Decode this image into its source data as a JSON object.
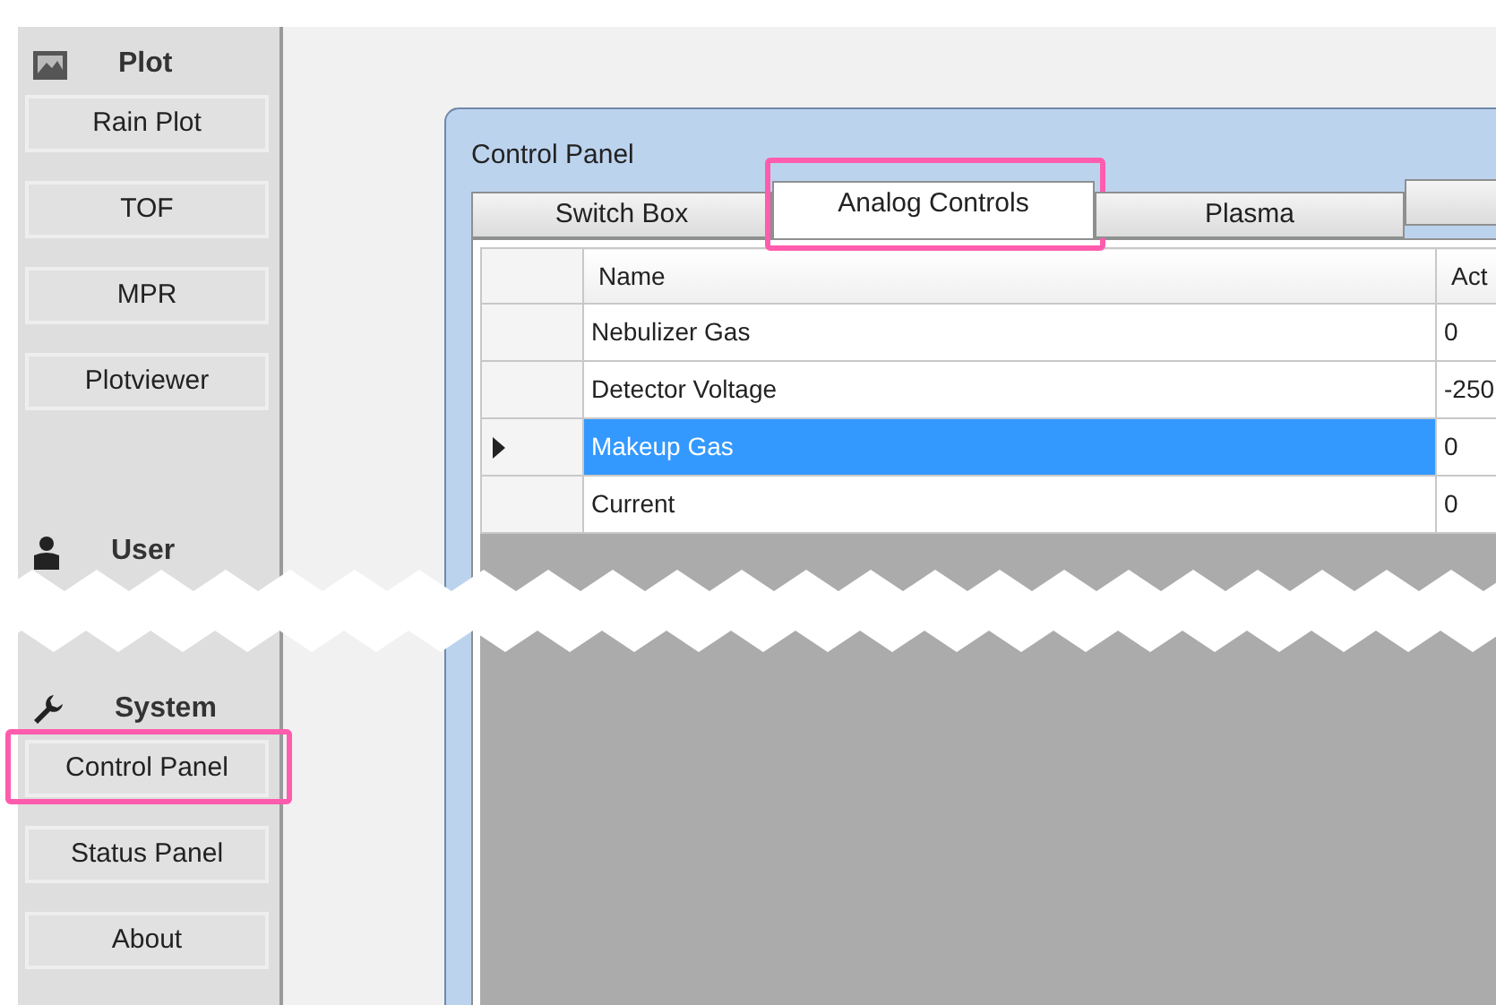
{
  "sidebar": {
    "sections": [
      {
        "title": "Plot",
        "buttons": [
          {
            "label": "Rain Plot",
            "highlighted": false
          },
          {
            "label": "TOF",
            "highlighted": false
          },
          {
            "label": "MPR",
            "highlighted": false
          },
          {
            "label": "Plotviewer",
            "highlighted": false
          }
        ]
      },
      {
        "title": "User"
      },
      {
        "title": "System",
        "buttons": [
          {
            "label": "Control Panel",
            "highlighted": true
          },
          {
            "label": "Status Panel",
            "highlighted": false
          },
          {
            "label": "About",
            "highlighted": false
          }
        ]
      }
    ]
  },
  "window": {
    "title": "Control Panel",
    "tabs": [
      {
        "label": "Switch Box",
        "selected": false,
        "highlighted": false
      },
      {
        "label": "Analog Controls",
        "selected": true,
        "highlighted": true
      },
      {
        "label": "Plasma",
        "selected": false,
        "highlighted": false
      },
      {
        "selected": false,
        "highlighted": false
      }
    ],
    "table": {
      "columns": [
        "Name",
        "Act"
      ],
      "rows": [
        {
          "cells": [
            "Nebulizer Gas",
            "0"
          ],
          "selected": false
        },
        {
          "cells": [
            "Detector Voltage",
            "-250"
          ],
          "selected": false
        },
        {
          "cells": [
            "Makeup Gas",
            "0"
          ],
          "selected": true
        },
        {
          "cells": [
            "Current",
            "0"
          ],
          "selected": false
        }
      ]
    }
  }
}
